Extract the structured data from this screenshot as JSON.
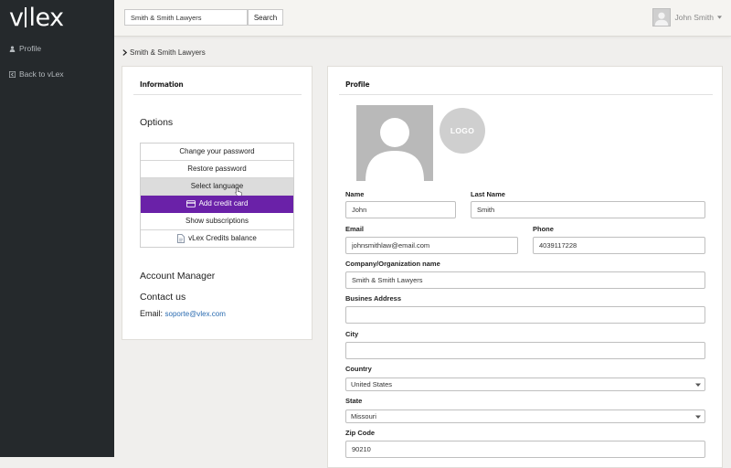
{
  "brand": {
    "logo_left": "v",
    "logo_right": "lex"
  },
  "sidebar": {
    "items": [
      {
        "label": "Profile",
        "icon": "user-icon"
      },
      {
        "label": "Back to vLex",
        "icon": "back-square-icon"
      }
    ]
  },
  "header": {
    "search": {
      "value": "Smith & Smith Lawyers",
      "button_label": "Search"
    },
    "user": {
      "name": "John Smith"
    }
  },
  "breadcrumb": {
    "current": "Smith & Smith Lawyers"
  },
  "info_panel": {
    "title": "Information",
    "options_title": "Options",
    "options": [
      {
        "label": "Change your password",
        "state": "normal"
      },
      {
        "label": "Restore password",
        "state": "normal"
      },
      {
        "label": "Select language",
        "state": "hover"
      },
      {
        "label": "Add credit card",
        "state": "active",
        "icon": "credit-card-icon"
      },
      {
        "label": "Show subscriptions",
        "state": "normal"
      },
      {
        "label": "vLex Credits balance",
        "state": "normal",
        "icon": "document-icon"
      }
    ],
    "account_manager": "Account Manager",
    "contact_us": "Contact us",
    "email_label": "Email:",
    "email": "soporte@vlex.com"
  },
  "profile_panel": {
    "title": "Profile",
    "logo_text": "LOGO",
    "fields": {
      "name": {
        "label": "Name",
        "value": "John"
      },
      "last_name": {
        "label": "Last Name",
        "value": "Smith"
      },
      "email": {
        "label": "Email",
        "value": "johnsmithlaw@email.com"
      },
      "phone": {
        "label": "Phone",
        "value": "4039117228"
      },
      "company": {
        "label": "Company/Organization name",
        "value": "Smith & Smith Lawyers"
      },
      "address": {
        "label": "Busines Address",
        "value": ""
      },
      "city": {
        "label": "City",
        "value": ""
      },
      "country": {
        "label": "Country",
        "value": "United States"
      },
      "state": {
        "label": "State",
        "value": "Missouri"
      },
      "zip": {
        "label": "Zip Code",
        "value": "90210"
      }
    }
  },
  "colors": {
    "sidebar": "#25292c",
    "accent": "#6a21a8",
    "link": "#2a6bb0"
  }
}
